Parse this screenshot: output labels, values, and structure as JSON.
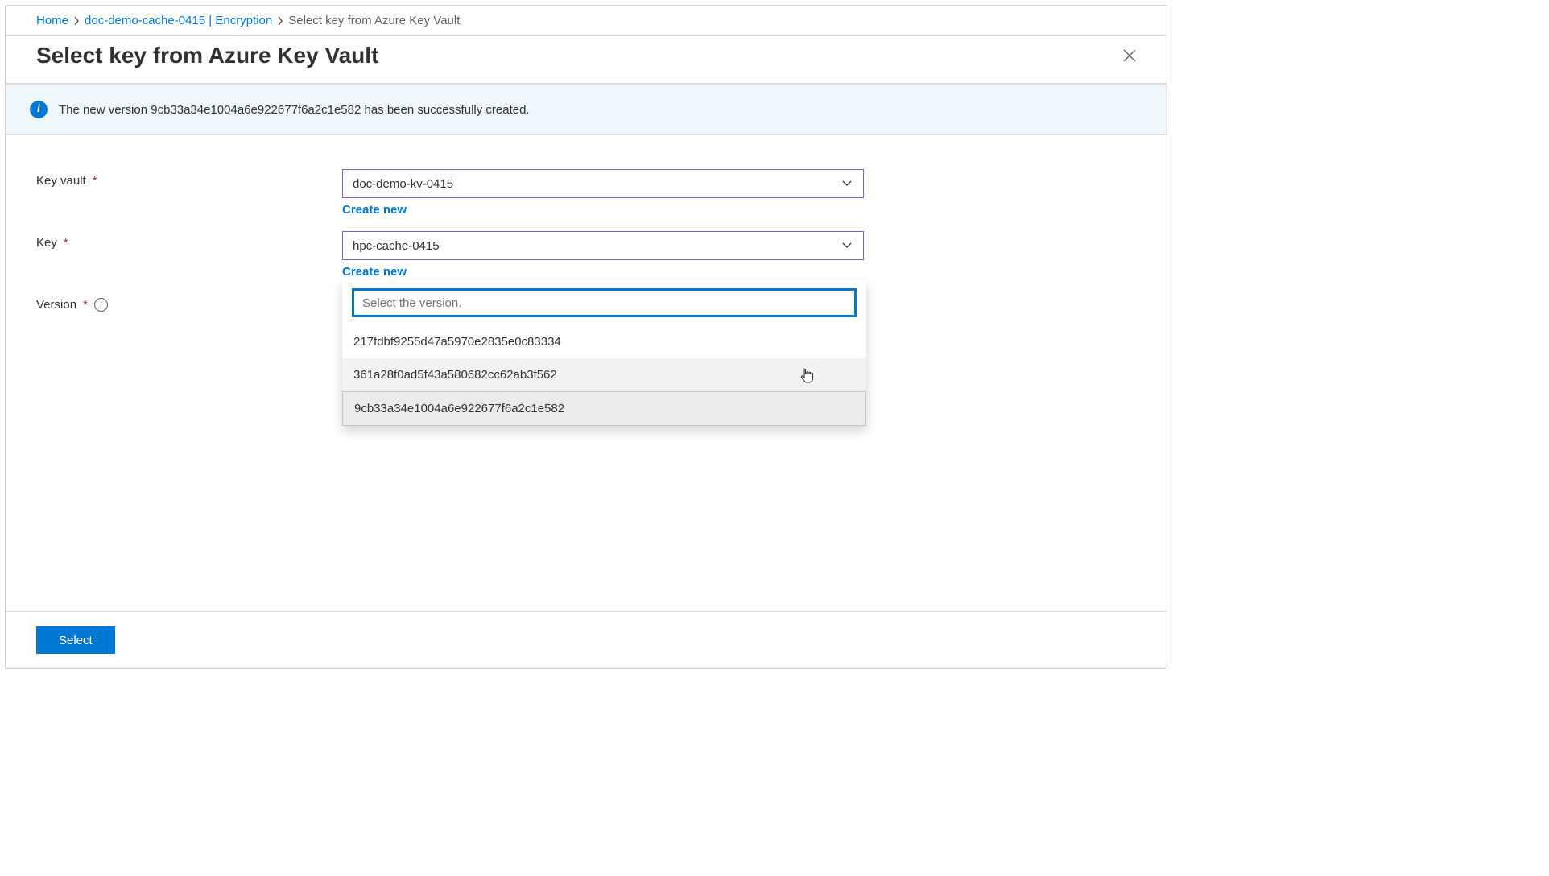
{
  "breadcrumb": {
    "home": "Home",
    "resource": "doc-demo-cache-0415",
    "subsection": "Encryption",
    "current": "Select key from Azure Key Vault"
  },
  "title": "Select key from Azure Key Vault",
  "info_banner": "The new version 9cb33a34e1004a6e922677f6a2c1e582 has been successfully created.",
  "form": {
    "key_vault": {
      "label": "Key vault",
      "value": "doc-demo-kv-0415",
      "create_link": "Create new"
    },
    "key": {
      "label": "Key",
      "value": "hpc-cache-0415",
      "create_link": "Create new"
    },
    "version": {
      "label": "Version",
      "value": "9cb33a34e1004a6e922677f6a2c1e582",
      "search_placeholder": "Select the version.",
      "options": [
        "217fdbf9255d47a5970e2835e0c83334",
        "361a28f0ad5f43a580682cc62ab3f562",
        "9cb33a34e1004a6e922677f6a2c1e582"
      ]
    }
  },
  "footer": {
    "select_button": "Select"
  }
}
